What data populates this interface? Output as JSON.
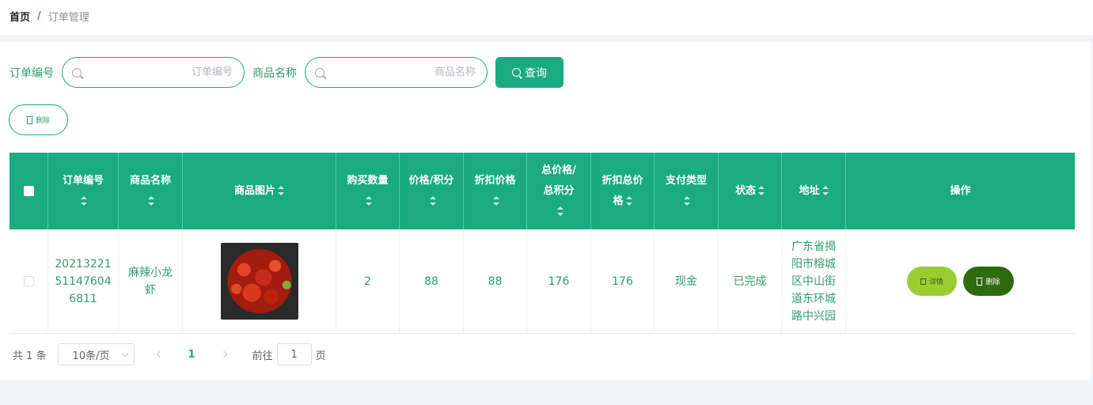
{
  "breadcrumb": {
    "home": "首页",
    "separator": "/",
    "current": "订单管理"
  },
  "search": {
    "order_no_label": "订单编号",
    "order_no_placeholder": "订单编号",
    "product_name_label": "商品名称",
    "product_name_placeholder": "商品名称",
    "query_button": "查询"
  },
  "toolbar": {
    "delete_label": "删除"
  },
  "table": {
    "columns": [
      "订单编号",
      "商品名称",
      "商品图片",
      "购买数量",
      "价格/积分",
      "折扣价格",
      "总价格/总积分",
      "折扣总价格",
      "支付类型",
      "状态",
      "地址",
      "操作"
    ],
    "rows": [
      {
        "order_no": "20213221511476046811",
        "product_name": "麻辣小龙虾",
        "product_image": "crayfish-photo",
        "quantity": "2",
        "price": "88",
        "discount_price": "88",
        "total_price": "176",
        "discount_total": "176",
        "pay_type": "现金",
        "status": "已完成",
        "address": "广东省揭阳市榕城区中山街道东环城路中兴园",
        "detail_button": "详情",
        "delete_button": "删除"
      }
    ]
  },
  "pagination": {
    "total": "共 1 条",
    "page_size": "10条/页",
    "current_page": "1",
    "goto_label": "前往",
    "goto_value": "1",
    "page_unit": "页"
  },
  "colors": {
    "accent": "#1aab7e",
    "detail_button": "#9acd32",
    "delete_button": "#2e6a0f"
  }
}
